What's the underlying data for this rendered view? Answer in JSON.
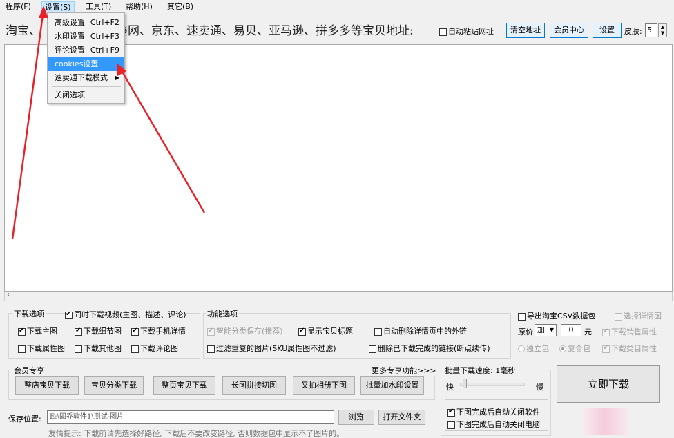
{
  "menubar": {
    "items": [
      "程序(F)",
      "设置(S)",
      "工具(T)",
      "帮助(H)",
      "其它(B)"
    ]
  },
  "settings_menu": {
    "items": [
      {
        "label": "高级设置",
        "shortcut": "Ctrl+F2"
      },
      {
        "label": "水印设置",
        "shortcut": "Ctrl+F3"
      },
      {
        "label": "评论设置",
        "shortcut": "Ctrl+F9"
      },
      {
        "label": "cookies设置",
        "shortcut": ""
      },
      {
        "label": "速卖通下载模式",
        "shortcut": ""
      },
      {
        "label": "关闭选项",
        "shortcut": ""
      }
    ]
  },
  "urlbar": {
    "prompt_left": "淘宝、",
    "prompt_right": "煌网、京东、速卖通、易贝、亚马逊、拼多多等宝贝地址:",
    "auto_paste": "自动粘贴网址",
    "clear_btn": "清空地址",
    "member_btn": "会员中心",
    "settings_btn": "设置",
    "skin_label": "皮肤:",
    "skin_value": "5"
  },
  "download_options": {
    "title": "下载选项",
    "video": "同时下载视频(主图、描述、评论)",
    "main_img": "下载主图",
    "detail_img": "下载细节图",
    "mobile_detail": "下载手机详情",
    "attr_img": "下载属性图",
    "other_img": "下载其他图",
    "review_img": "下载评论图"
  },
  "function_options": {
    "title": "功能选项",
    "smart_sort": "智能分类保存(推荐)",
    "show_title": "显示宝贝标题",
    "auto_delete_links": "自动删除详情页中的外链",
    "filter_dup": "过滤重复的图片(SKU属性图不过滤)",
    "delete_done": "删除已下载完成的链接(断点续传)"
  },
  "csv": {
    "export": "导出淘宝CSV数据包",
    "select_detail": "选择详情图",
    "price_label": "原价",
    "price_op": "加",
    "price_value": "0",
    "price_unit": "元",
    "sales_attr": "下载销售属性",
    "single_pkg": "独立包",
    "combined_pkg": "复合包",
    "category_attr": "下载类目属性"
  },
  "vip": {
    "title": "会员专享",
    "more": "更多专享功能>>>",
    "buttons": [
      "整店宝贝下载",
      "宝贝分类下载",
      "整页宝贝下载",
      "长图拼接切图",
      "又拍相册下图",
      "批量加水印设置"
    ]
  },
  "batch": {
    "title": "批量下载速度: 1毫秒",
    "fast": "快",
    "slow": "慢",
    "speed_level": 0.05,
    "close_software": "下图完成后自动关闭软件",
    "shutdown_pc": "下图完成后自动关闭电脑"
  },
  "download_now": "立即下载",
  "save": {
    "label": "保存位置:",
    "path": "E:\\固乔软件1\\测试-图片",
    "browse": "浏览",
    "open_folder": "打开文件夹",
    "tip": "友情提示: 下载前请先选择好路径, 下载后不要改变路径, 否则数据包中显示不了图片的。"
  },
  "colors": {
    "annotation_arrow": "#e8222a",
    "menu_highlight": "#3399ff"
  }
}
